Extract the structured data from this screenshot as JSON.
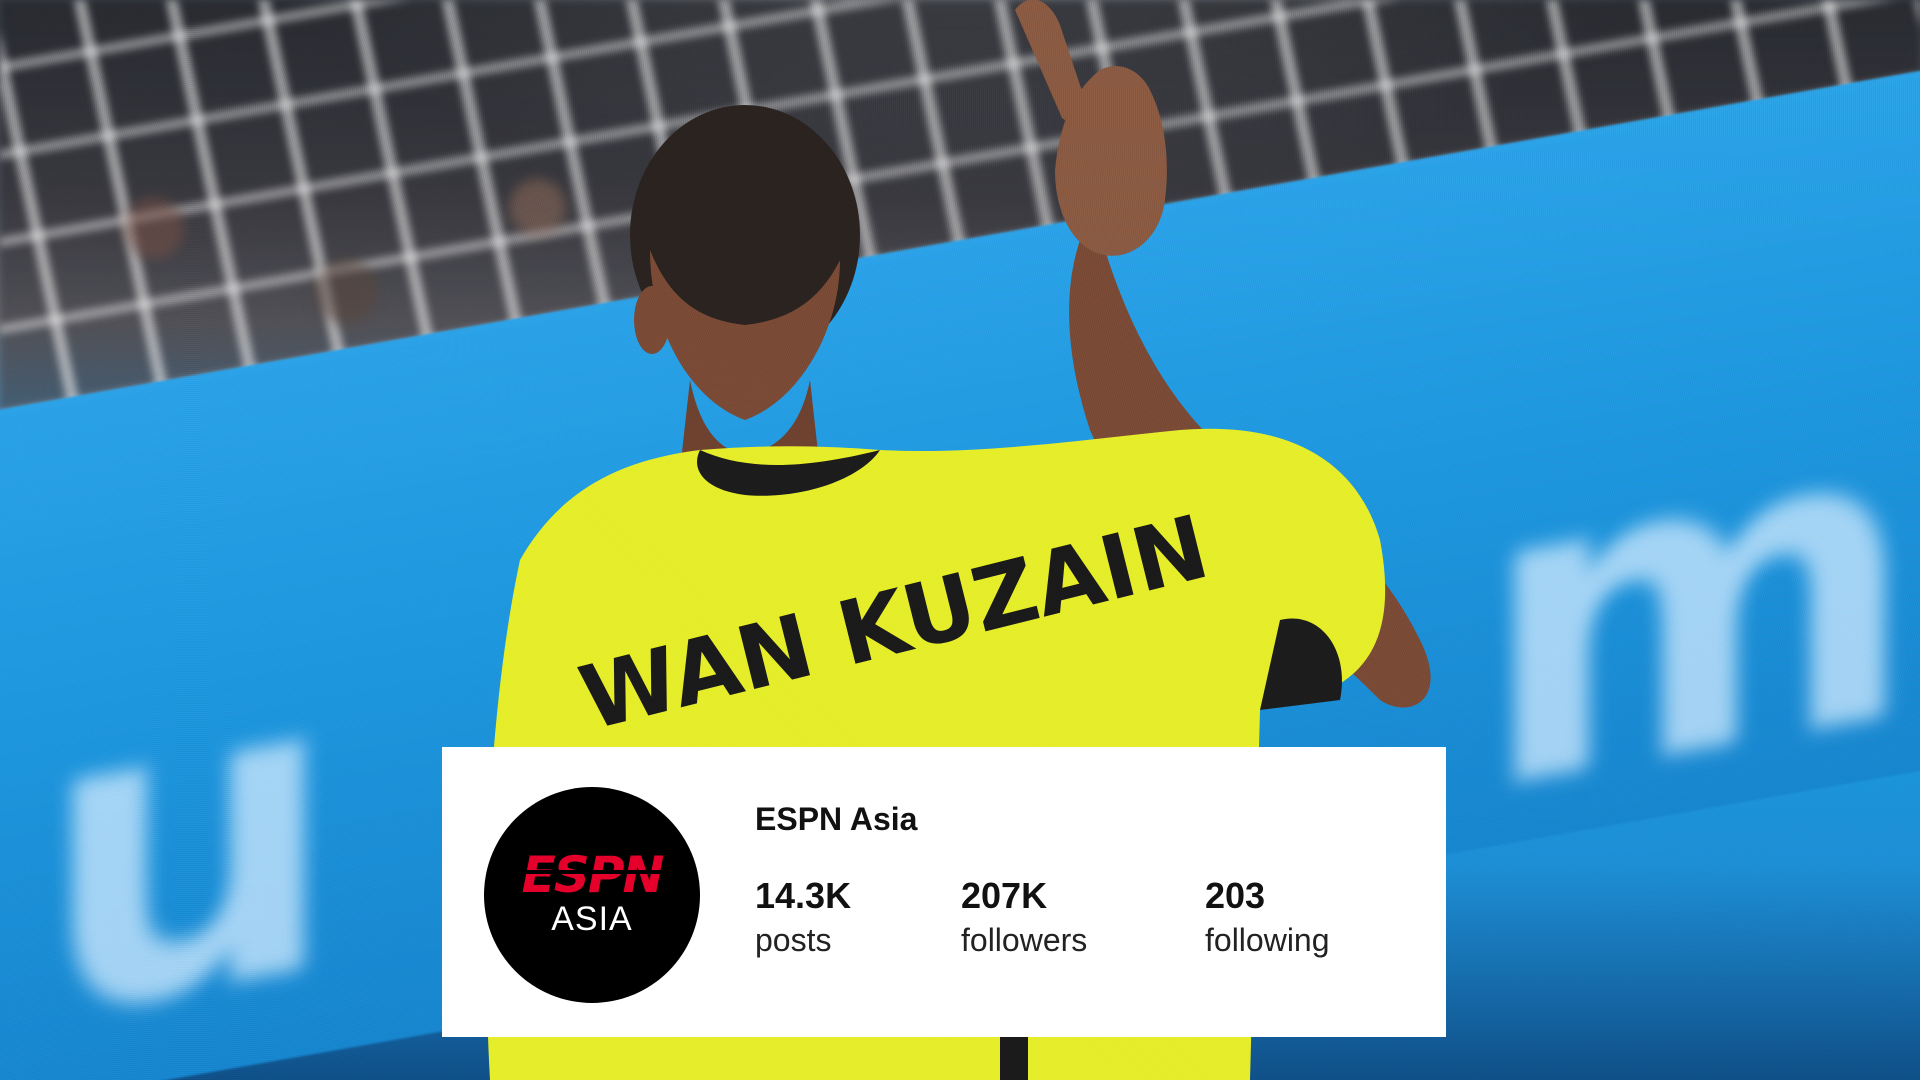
{
  "profile": {
    "name": "ESPN Asia",
    "avatar": {
      "logo_text": "ESPN",
      "sub_text": "ASIA",
      "logo_color": "#e4002b",
      "background_color": "#000000"
    },
    "stats": {
      "posts": {
        "value": "14.3K",
        "label": "posts"
      },
      "followers": {
        "value": "207K",
        "label": "followers"
      },
      "following": {
        "value": "203",
        "label": "following"
      }
    }
  },
  "photo": {
    "jersey_text": "WAN KUZAIN",
    "jersey_color": "#e8f028",
    "board_color": "#1f98df"
  }
}
